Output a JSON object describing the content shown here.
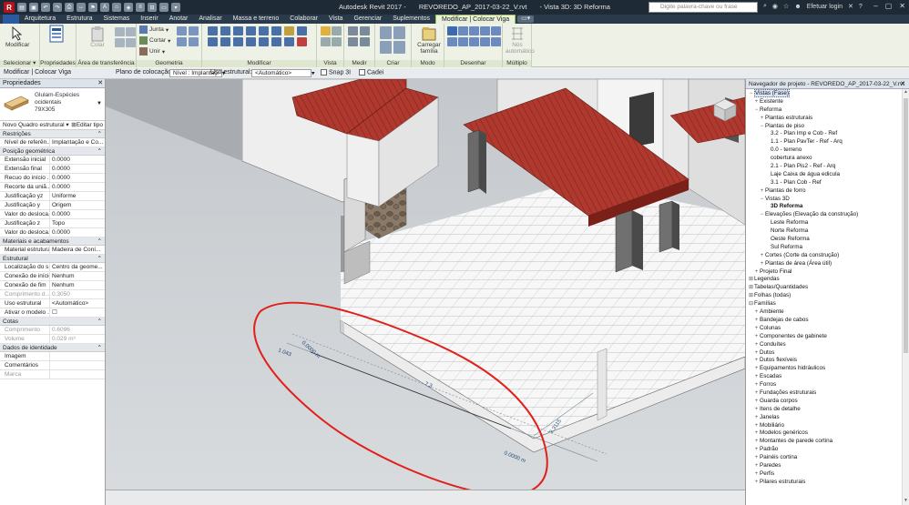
{
  "titlebar": {
    "app": "Autodesk Revit 2017 -",
    "file": "REVOREDO_AP_2017-03-22_V.rvt",
    "view": "- Vista 3D: 3D Reforma",
    "search_placeholder": "Digite palavra-chave ou frase",
    "login": "Efetuar login"
  },
  "ribbon_tabs": [
    "Arquitetura",
    "Estrutura",
    "Sistemas",
    "Inserir",
    "Anotar",
    "Analisar",
    "Massa e terreno",
    "Colaborar",
    "Vista",
    "Gerenciar",
    "Suplementos",
    "Modificar | Colocar Viga"
  ],
  "ribbon": {
    "modificar_label": "Modificar",
    "colar_label": "Colar",
    "junta_label": "Junta",
    "cortar_label": "Cortar",
    "unir_label": "Unir",
    "carregar_label": "Carregar família",
    "nos_label": "Nós automático",
    "panels": [
      "Selecionar ▾",
      "Propriedades",
      "Área de transferência",
      "Geometria",
      "Modificar",
      "Vista",
      "Medir",
      "Criar",
      "Modo",
      "Desenhar",
      "Múltiplo"
    ]
  },
  "optbar": {
    "context": "Modificar | Colocar Viga",
    "plane_label": "Plano de colocação:",
    "plane_value": "Nível : Implantaçi",
    "usage_label": "Uso estrutural:",
    "usage_value": "<Automático>",
    "snap_label": "Snap 3I",
    "chain_label": "Cadei"
  },
  "properties": {
    "header": "Propriedades",
    "type_name_1": "Glulam-Espécies",
    "type_name_2": "ocidentais",
    "type_name_3": "79X305",
    "instance": "Novo Quadro estrutural",
    "edit_type": "Editar tipo",
    "sections": [
      {
        "title": "Restrições",
        "rows": [
          {
            "k": "Nível de referên...",
            "v": "Implantação e Co...",
            "dim": false
          }
        ]
      },
      {
        "title": "Posição geométrica",
        "rows": [
          {
            "k": "Extensão inicial",
            "v": "0.0000",
            "dim": false
          },
          {
            "k": "Extensão final",
            "v": "0.0000",
            "dim": false
          },
          {
            "k": "Recuo do início ...",
            "v": "0.0000",
            "dim": false
          },
          {
            "k": "Recorte da uniã...",
            "v": "0.0000",
            "dim": false
          },
          {
            "k": "Justificação yz",
            "v": "Uniforme",
            "dim": false
          },
          {
            "k": "Justificação y",
            "v": "Origem",
            "dim": false
          },
          {
            "k": "Valor do desloca...",
            "v": "0.0000",
            "dim": false
          },
          {
            "k": "Justificação z",
            "v": "Topo",
            "dim": false
          },
          {
            "k": "Valor do desloca...",
            "v": "0.0000",
            "dim": false
          }
        ]
      },
      {
        "title": "Materiais e acabamentos",
        "rows": [
          {
            "k": "Material estrutural",
            "v": "Madeira de Coní...",
            "dim": false
          }
        ]
      },
      {
        "title": "Estrutural",
        "rows": [
          {
            "k": "Localização do sí...",
            "v": "Centro da geome...",
            "dim": false
          },
          {
            "k": "Conexão de início",
            "v": "Nenhum",
            "dim": false
          },
          {
            "k": "Conexão de fim",
            "v": "Nenhum",
            "dim": false
          },
          {
            "k": "Comprimento d...",
            "v": "0.3050",
            "dim": true
          },
          {
            "k": "Uso estrutural",
            "v": "<Automático>",
            "dim": false
          },
          {
            "k": "Ativar o modelo ...",
            "v": "☐",
            "dim": false
          }
        ]
      },
      {
        "title": "Cotas",
        "rows": [
          {
            "k": "Comprimento",
            "v": "0.6096",
            "dim": true
          },
          {
            "k": "Volume",
            "v": "0.029 m³",
            "dim": true
          }
        ]
      },
      {
        "title": "Dados de identidade",
        "rows": [
          {
            "k": "Imagem",
            "v": "",
            "dim": false
          },
          {
            "k": "Comentários",
            "v": "",
            "dim": false
          },
          {
            "k": "Marca",
            "v": "",
            "dim": true
          }
        ]
      }
    ]
  },
  "viewport": {
    "dim_a": "0.0000 m",
    "dim_b": "1.043",
    "dim_c": "7.3",
    "dim_d": "0.0000 m",
    "dim_e": "3.3115"
  },
  "browser": {
    "header": "Navegador de projeto - REVOREDO_AP_2017-03-22_V.rvt",
    "nodes": [
      {
        "t": "Vistas (Fase)",
        "l": 0,
        "tog": "−",
        "sel": true
      },
      {
        "t": "Existente",
        "l": 1,
        "tog": "+"
      },
      {
        "t": "Reforma",
        "l": 1,
        "tog": "−"
      },
      {
        "t": "Plantas estruturais",
        "l": 2,
        "tog": "+"
      },
      {
        "t": "Plantas de piso",
        "l": 2,
        "tog": "−"
      },
      {
        "t": "3.2 - Plan Imp e Cob - Ref",
        "l": 3,
        "tog": ""
      },
      {
        "t": "1.1 - Plan PavTer - Ref - Arq",
        "l": 3,
        "tog": ""
      },
      {
        "t": "0.0 - terreno",
        "l": 3,
        "tog": ""
      },
      {
        "t": "cobertura anexo",
        "l": 3,
        "tog": ""
      },
      {
        "t": "2.1 - Plan Pis2 - Ref - Arq",
        "l": 3,
        "tog": ""
      },
      {
        "t": "Laje Caixa de água edicula",
        "l": 3,
        "tog": ""
      },
      {
        "t": "3.1 - Plan Cob - Ref",
        "l": 3,
        "tog": ""
      },
      {
        "t": "Plantas de forro",
        "l": 2,
        "tog": "+"
      },
      {
        "t": "Vistas 3D",
        "l": 2,
        "tog": "−"
      },
      {
        "t": "3D Reforma",
        "l": 3,
        "tog": "",
        "bold": true
      },
      {
        "t": "Elevações (Elevação da construção)",
        "l": 2,
        "tog": "−"
      },
      {
        "t": "Leste Reforma",
        "l": 3,
        "tog": ""
      },
      {
        "t": "Norte Reforma",
        "l": 3,
        "tog": ""
      },
      {
        "t": "Oeste Reforma",
        "l": 3,
        "tog": ""
      },
      {
        "t": "Sul Reforma",
        "l": 3,
        "tog": ""
      },
      {
        "t": "Cortes (Corte da construção)",
        "l": 2,
        "tog": "+"
      },
      {
        "t": "Plantas de área (Área útil)",
        "l": 2,
        "tog": "+"
      },
      {
        "t": "Projeto Final",
        "l": 1,
        "tog": "+"
      },
      {
        "t": "Legendas",
        "l": 0,
        "tog": "⊞"
      },
      {
        "t": "Tabelas/Quantidades",
        "l": 0,
        "tog": "⊞"
      },
      {
        "t": "Folhas (todas)",
        "l": 0,
        "tog": "⊞"
      },
      {
        "t": "Famílias",
        "l": 0,
        "tog": "⊟"
      },
      {
        "t": "Ambiente",
        "l": 1,
        "tog": "+"
      },
      {
        "t": "Bandejas de cabos",
        "l": 1,
        "tog": "+"
      },
      {
        "t": "Colunas",
        "l": 1,
        "tog": "+"
      },
      {
        "t": "Componentes de gabinete",
        "l": 1,
        "tog": "+"
      },
      {
        "t": "Conduítes",
        "l": 1,
        "tog": "+"
      },
      {
        "t": "Dutos",
        "l": 1,
        "tog": "+"
      },
      {
        "t": "Dutos flexíveis",
        "l": 1,
        "tog": "+"
      },
      {
        "t": "Equipamentos hidráulicos",
        "l": 1,
        "tog": "+"
      },
      {
        "t": "Escadas",
        "l": 1,
        "tog": "+"
      },
      {
        "t": "Forros",
        "l": 1,
        "tog": "+"
      },
      {
        "t": "Fundações estruturais",
        "l": 1,
        "tog": "+"
      },
      {
        "t": "Guarda corpos",
        "l": 1,
        "tog": "+"
      },
      {
        "t": "Itens de detalhe",
        "l": 1,
        "tog": "+"
      },
      {
        "t": "Janelas",
        "l": 1,
        "tog": "+"
      },
      {
        "t": "Mobiliário",
        "l": 1,
        "tog": "+"
      },
      {
        "t": "Modelos genéricos",
        "l": 1,
        "tog": "+"
      },
      {
        "t": "Montantes de parede cortina",
        "l": 1,
        "tog": "+"
      },
      {
        "t": "Padrão",
        "l": 1,
        "tog": "+"
      },
      {
        "t": "Painéis cortina",
        "l": 1,
        "tog": "+"
      },
      {
        "t": "Paredes",
        "l": 1,
        "tog": "+"
      },
      {
        "t": "Perfis",
        "l": 1,
        "tog": "+"
      },
      {
        "t": "Pilares estruturais",
        "l": 1,
        "tog": "+"
      }
    ]
  }
}
